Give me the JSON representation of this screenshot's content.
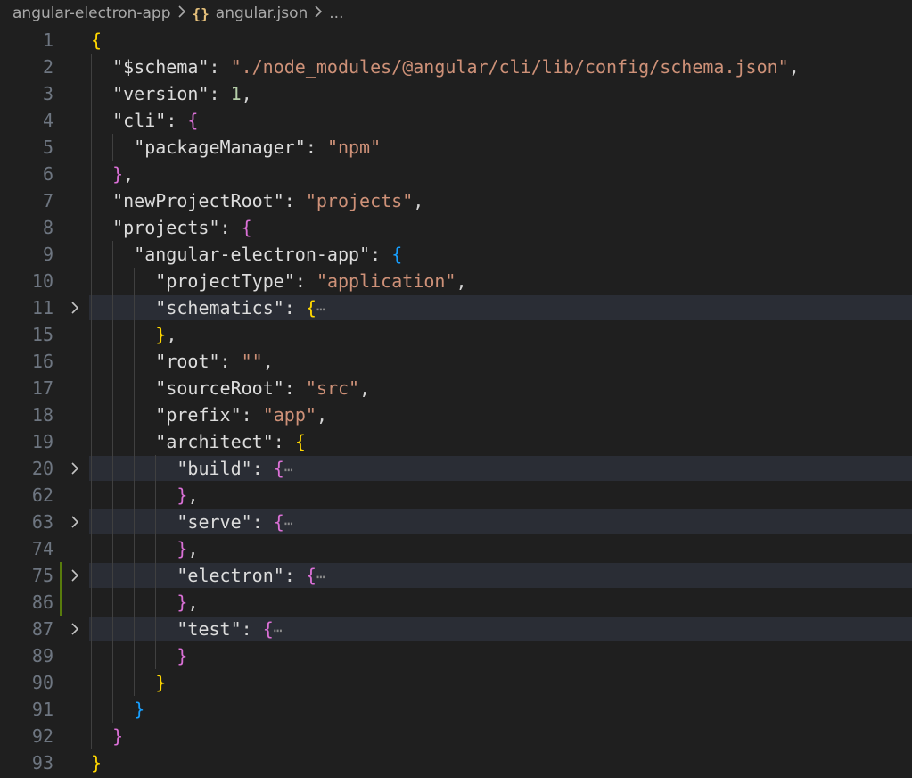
{
  "breadcrumb": {
    "folder": "angular-electron-app",
    "file_icon": "{}",
    "file": "angular.json",
    "more": "..."
  },
  "colors": {
    "background": "#1f1f1f",
    "folded_line_highlight": "#2a2d35",
    "modified_gutter": "#587c0c",
    "string": "#ce9178",
    "number": "#b5cea8",
    "bracket_level1": "#ffd700",
    "bracket_level2": "#da70d6",
    "bracket_level3": "#179fff"
  },
  "editor": {
    "lines": [
      {
        "n": "1",
        "indent": 0,
        "folded": false,
        "modified": false,
        "tokens": [
          {
            "t": "{",
            "c": "b1"
          }
        ]
      },
      {
        "n": "2",
        "indent": 1,
        "folded": false,
        "modified": false,
        "tokens": [
          {
            "t": "\"$schema\"",
            "c": "key"
          },
          {
            "t": ": ",
            "c": "p"
          },
          {
            "t": "\"./node_modules/@angular/cli/lib/config/schema.json\"",
            "c": "s"
          },
          {
            "t": ",",
            "c": "p"
          }
        ]
      },
      {
        "n": "3",
        "indent": 1,
        "folded": false,
        "modified": false,
        "tokens": [
          {
            "t": "\"version\"",
            "c": "key"
          },
          {
            "t": ": ",
            "c": "p"
          },
          {
            "t": "1",
            "c": "n"
          },
          {
            "t": ",",
            "c": "p"
          }
        ]
      },
      {
        "n": "4",
        "indent": 1,
        "folded": false,
        "modified": false,
        "tokens": [
          {
            "t": "\"cli\"",
            "c": "key"
          },
          {
            "t": ": ",
            "c": "p"
          },
          {
            "t": "{",
            "c": "b2"
          }
        ]
      },
      {
        "n": "5",
        "indent": 2,
        "folded": false,
        "modified": false,
        "tokens": [
          {
            "t": "\"packageManager\"",
            "c": "key"
          },
          {
            "t": ": ",
            "c": "p"
          },
          {
            "t": "\"npm\"",
            "c": "s"
          }
        ]
      },
      {
        "n": "6",
        "indent": 1,
        "folded": false,
        "modified": false,
        "tokens": [
          {
            "t": "}",
            "c": "b2"
          },
          {
            "t": ",",
            "c": "p"
          }
        ]
      },
      {
        "n": "7",
        "indent": 1,
        "folded": false,
        "modified": false,
        "tokens": [
          {
            "t": "\"newProjectRoot\"",
            "c": "key"
          },
          {
            "t": ": ",
            "c": "p"
          },
          {
            "t": "\"projects\"",
            "c": "s"
          },
          {
            "t": ",",
            "c": "p"
          }
        ]
      },
      {
        "n": "8",
        "indent": 1,
        "folded": false,
        "modified": false,
        "tokens": [
          {
            "t": "\"projects\"",
            "c": "key"
          },
          {
            "t": ": ",
            "c": "p"
          },
          {
            "t": "{",
            "c": "b2"
          }
        ]
      },
      {
        "n": "9",
        "indent": 2,
        "folded": false,
        "modified": false,
        "tokens": [
          {
            "t": "\"angular-electron-app\"",
            "c": "key"
          },
          {
            "t": ": ",
            "c": "p"
          },
          {
            "t": "{",
            "c": "b3"
          }
        ]
      },
      {
        "n": "10",
        "indent": 3,
        "folded": false,
        "modified": false,
        "tokens": [
          {
            "t": "\"projectType\"",
            "c": "key"
          },
          {
            "t": ": ",
            "c": "p"
          },
          {
            "t": "\"application\"",
            "c": "s"
          },
          {
            "t": ",",
            "c": "p"
          }
        ]
      },
      {
        "n": "11",
        "indent": 3,
        "folded": true,
        "modified": false,
        "tokens": [
          {
            "t": "\"schematics\"",
            "c": "key"
          },
          {
            "t": ": ",
            "c": "p"
          },
          {
            "t": "{",
            "c": "b1"
          },
          {
            "t": "⋯",
            "c": "ell"
          }
        ]
      },
      {
        "n": "15",
        "indent": 3,
        "folded": false,
        "modified": false,
        "tokens": [
          {
            "t": "}",
            "c": "b1"
          },
          {
            "t": ",",
            "c": "p"
          }
        ]
      },
      {
        "n": "16",
        "indent": 3,
        "folded": false,
        "modified": false,
        "tokens": [
          {
            "t": "\"root\"",
            "c": "key"
          },
          {
            "t": ": ",
            "c": "p"
          },
          {
            "t": "\"\"",
            "c": "s"
          },
          {
            "t": ",",
            "c": "p"
          }
        ]
      },
      {
        "n": "17",
        "indent": 3,
        "folded": false,
        "modified": false,
        "tokens": [
          {
            "t": "\"sourceRoot\"",
            "c": "key"
          },
          {
            "t": ": ",
            "c": "p"
          },
          {
            "t": "\"src\"",
            "c": "s"
          },
          {
            "t": ",",
            "c": "p"
          }
        ]
      },
      {
        "n": "18",
        "indent": 3,
        "folded": false,
        "modified": false,
        "tokens": [
          {
            "t": "\"prefix\"",
            "c": "key"
          },
          {
            "t": ": ",
            "c": "p"
          },
          {
            "t": "\"app\"",
            "c": "s"
          },
          {
            "t": ",",
            "c": "p"
          }
        ]
      },
      {
        "n": "19",
        "indent": 3,
        "folded": false,
        "modified": false,
        "tokens": [
          {
            "t": "\"architect\"",
            "c": "key"
          },
          {
            "t": ": ",
            "c": "p"
          },
          {
            "t": "{",
            "c": "b1"
          }
        ]
      },
      {
        "n": "20",
        "indent": 4,
        "folded": true,
        "modified": false,
        "tokens": [
          {
            "t": "\"build\"",
            "c": "key"
          },
          {
            "t": ": ",
            "c": "p"
          },
          {
            "t": "{",
            "c": "b2"
          },
          {
            "t": "⋯",
            "c": "ell"
          }
        ]
      },
      {
        "n": "62",
        "indent": 4,
        "folded": false,
        "modified": false,
        "tokens": [
          {
            "t": "}",
            "c": "b2"
          },
          {
            "t": ",",
            "c": "p"
          }
        ]
      },
      {
        "n": "63",
        "indent": 4,
        "folded": true,
        "modified": false,
        "tokens": [
          {
            "t": "\"serve\"",
            "c": "key"
          },
          {
            "t": ": ",
            "c": "p"
          },
          {
            "t": "{",
            "c": "b2"
          },
          {
            "t": "⋯",
            "c": "ell"
          }
        ]
      },
      {
        "n": "74",
        "indent": 4,
        "folded": false,
        "modified": false,
        "tokens": [
          {
            "t": "}",
            "c": "b2"
          },
          {
            "t": ",",
            "c": "p"
          }
        ]
      },
      {
        "n": "75",
        "indent": 4,
        "folded": true,
        "modified": true,
        "tokens": [
          {
            "t": "\"electron\"",
            "c": "key"
          },
          {
            "t": ": ",
            "c": "p"
          },
          {
            "t": "{",
            "c": "b2"
          },
          {
            "t": "⋯",
            "c": "ell"
          }
        ]
      },
      {
        "n": "86",
        "indent": 4,
        "folded": false,
        "modified": true,
        "tokens": [
          {
            "t": "}",
            "c": "b2"
          },
          {
            "t": ",",
            "c": "p"
          }
        ]
      },
      {
        "n": "87",
        "indent": 4,
        "folded": true,
        "modified": false,
        "tokens": [
          {
            "t": "\"test\"",
            "c": "key"
          },
          {
            "t": ": ",
            "c": "p"
          },
          {
            "t": "{",
            "c": "b2"
          },
          {
            "t": "⋯",
            "c": "ell"
          }
        ]
      },
      {
        "n": "89",
        "indent": 4,
        "folded": false,
        "modified": false,
        "tokens": [
          {
            "t": "}",
            "c": "b2"
          }
        ]
      },
      {
        "n": "90",
        "indent": 3,
        "folded": false,
        "modified": false,
        "tokens": [
          {
            "t": "}",
            "c": "b1"
          }
        ]
      },
      {
        "n": "91",
        "indent": 2,
        "folded": false,
        "modified": false,
        "tokens": [
          {
            "t": "}",
            "c": "b3"
          }
        ]
      },
      {
        "n": "92",
        "indent": 1,
        "folded": false,
        "modified": false,
        "tokens": [
          {
            "t": "}",
            "c": "b2"
          }
        ]
      },
      {
        "n": "93",
        "indent": 0,
        "folded": false,
        "modified": false,
        "tokens": [
          {
            "t": "}",
            "c": "b1"
          }
        ]
      }
    ]
  }
}
